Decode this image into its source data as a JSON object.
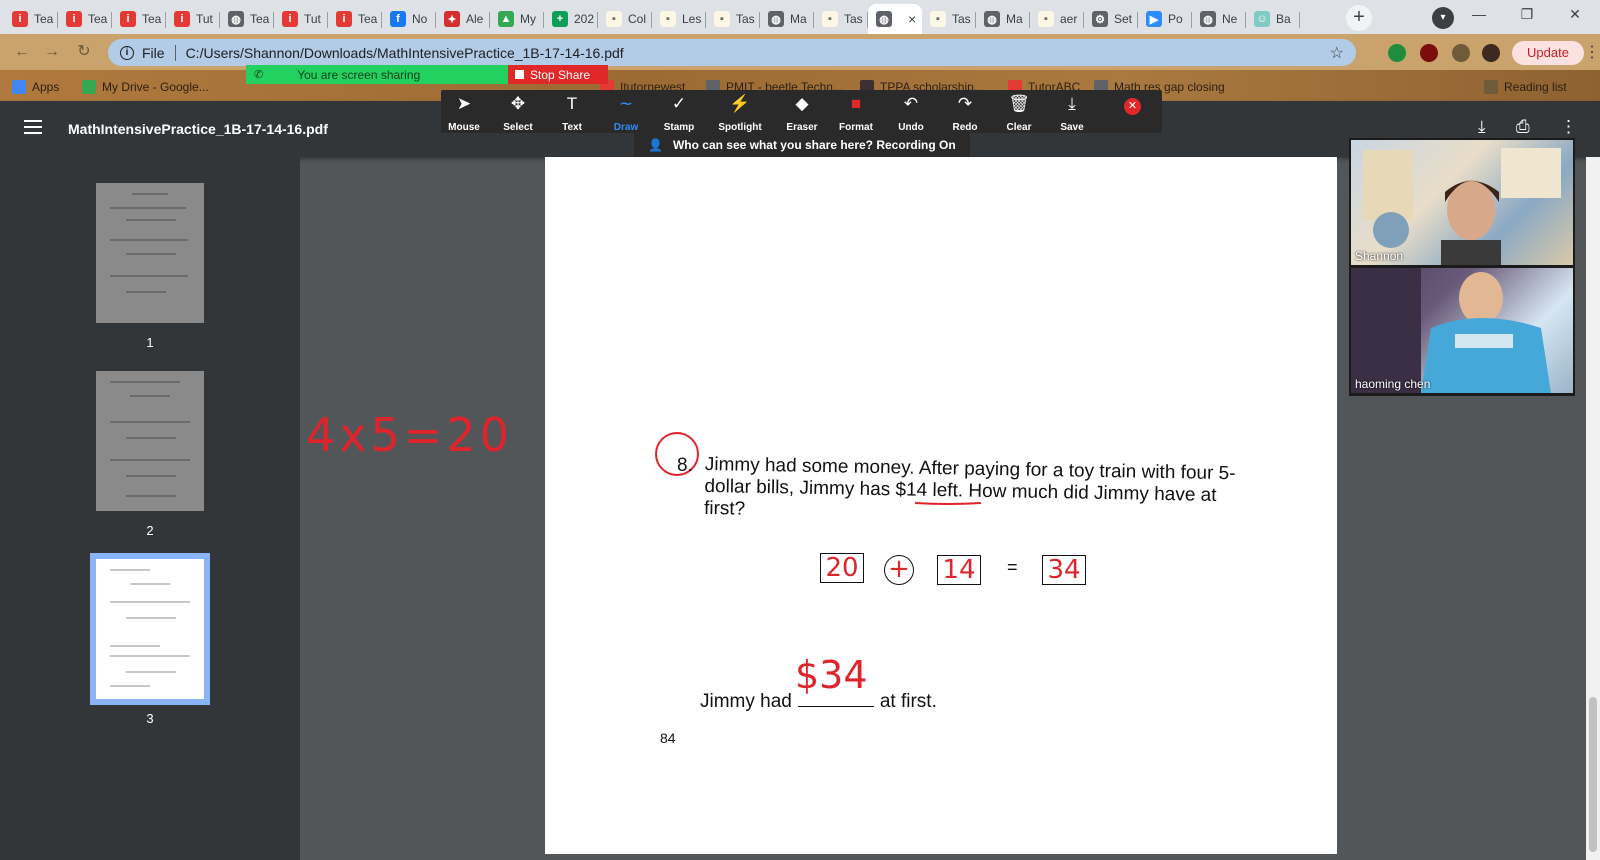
{
  "browser": {
    "tabs": [
      {
        "label": "Tea",
        "icon": "i-brand-icon",
        "color": "#e53935",
        "glyph": "i"
      },
      {
        "label": "Tea",
        "icon": "i-brand-icon",
        "color": "#e53935",
        "glyph": "i"
      },
      {
        "label": "Tea",
        "icon": "i-brand-icon",
        "color": "#e53935",
        "glyph": "i"
      },
      {
        "label": "Tut",
        "icon": "i-brand-icon",
        "color": "#e53935",
        "glyph": "i"
      },
      {
        "label": "Tea",
        "icon": "globe-icon",
        "color": "#5f6368",
        "glyph": "◍"
      },
      {
        "label": "Tut",
        "icon": "i-brand-icon",
        "color": "#e53935",
        "glyph": "i"
      },
      {
        "label": "Tea",
        "icon": "i-brand-icon",
        "color": "#e53935",
        "glyph": "i"
      },
      {
        "label": "No",
        "icon": "facebook-icon",
        "color": "#1877f2",
        "glyph": "f"
      },
      {
        "label": "Ale",
        "icon": "maple-leaf-icon",
        "color": "#d32f2f",
        "glyph": "✦"
      },
      {
        "label": "My",
        "icon": "drive-icon",
        "color": "#34a853",
        "glyph": "▲"
      },
      {
        "label": "202",
        "icon": "sheets-plus-icon",
        "color": "#0f9d58",
        "glyph": "+"
      },
      {
        "label": "Col",
        "icon": "document-icon",
        "color": "#fbf7e4",
        "glyph": "▪"
      },
      {
        "label": "Les",
        "icon": "document-icon",
        "color": "#fbf7e4",
        "glyph": "▪"
      },
      {
        "label": "Tas",
        "icon": "document-icon",
        "color": "#fbf7e4",
        "glyph": "▪"
      },
      {
        "label": "Ma",
        "icon": "globe-icon",
        "color": "#5f6368",
        "glyph": "◍"
      },
      {
        "label": "Tas",
        "icon": "document-icon",
        "color": "#fbf7e4",
        "glyph": "▪"
      },
      {
        "label": "",
        "icon": "globe-icon",
        "color": "#5f6368",
        "glyph": "◍",
        "active": true
      },
      {
        "label": "Tas",
        "icon": "document-icon",
        "color": "#fbf7e4",
        "glyph": "▪"
      },
      {
        "label": "Ma",
        "icon": "globe-icon",
        "color": "#5f6368",
        "glyph": "◍"
      },
      {
        "label": "aer",
        "icon": "document-icon",
        "color": "#fbf7e4",
        "glyph": "▪"
      },
      {
        "label": "Set",
        "icon": "gear-icon",
        "color": "#5f6368",
        "glyph": "⚙"
      },
      {
        "label": "Po",
        "icon": "zoom-icon",
        "color": "#2d8cff",
        "glyph": "▶"
      },
      {
        "label": "Ne",
        "icon": "chrome-icon",
        "color": "#5f6368",
        "glyph": "◍"
      },
      {
        "label": "Ba",
        "icon": "robot-icon",
        "color": "#80cbc4",
        "glyph": "☺"
      }
    ],
    "active_tab_close": "×",
    "new_tab": "+",
    "url_scheme_label": "File",
    "url": "C:/Users/Shannon/Downloads/MathIntensivePractice_1B-17-14-16.pdf",
    "update_label": "Update",
    "bookmarks": [
      {
        "label": "Apps",
        "color": "#4285f4"
      },
      {
        "label": "My Drive - Google...",
        "color": "#34a853"
      },
      {
        "label": "Itutornewest",
        "color": "#e53935"
      },
      {
        "label": "PMIT - beetle Techn...",
        "color": "#5f6368"
      },
      {
        "label": "TPPA scholarship...",
        "color": "#3c2f2f"
      },
      {
        "label": "TutorABC",
        "color": "#e53935"
      },
      {
        "label": "Math res gap closing",
        "color": "#5f6368"
      },
      {
        "label": "Reading list",
        "color": "#6f5a3a"
      }
    ]
  },
  "zoom": {
    "sharing_text": "You are screen sharing",
    "stop_share": "Stop Share",
    "tools": [
      {
        "label": "Mouse",
        "icon": "mouse-pointer-icon",
        "glyph": "➤"
      },
      {
        "label": "Select",
        "icon": "move-icon",
        "glyph": "✥"
      },
      {
        "label": "Text",
        "icon": "text-icon",
        "glyph": "T"
      },
      {
        "label": "Draw",
        "icon": "draw-icon",
        "glyph": "∼",
        "active": true
      },
      {
        "label": "Stamp",
        "icon": "stamp-check-icon",
        "glyph": "✓"
      },
      {
        "label": "Spotlight",
        "icon": "spotlight-wand-icon",
        "glyph": "⚡"
      },
      {
        "label": "Eraser",
        "icon": "eraser-icon",
        "glyph": "◆"
      },
      {
        "label": "Format",
        "icon": "format-color-icon",
        "glyph": "■"
      },
      {
        "label": "Undo",
        "icon": "undo-icon",
        "glyph": "↶"
      },
      {
        "label": "Redo",
        "icon": "redo-icon",
        "glyph": "↷"
      },
      {
        "label": "Clear",
        "icon": "trash-icon",
        "glyph": "🗑"
      },
      {
        "label": "Save",
        "icon": "save-download-icon",
        "glyph": "⤓"
      }
    ],
    "recording_notice": "Who can see what you share here? Recording On",
    "participants": [
      {
        "name": "Shannon"
      },
      {
        "name": "haoming  chen"
      }
    ]
  },
  "pdf": {
    "title": "MathIntensivePractice_1B-17-14-16.pdf",
    "thumbnails": [
      "1",
      "2",
      "3"
    ],
    "selected_page": "3",
    "question_number": "8.",
    "question_text": "Jimmy had some money. After paying for a toy train with four 5-dollar  bills, Jimmy has $14 left. How much did Jimmy have at first?",
    "answer_prefix": "Jimmy had",
    "answer_suffix": "at first.",
    "page_number": "84"
  },
  "annotations": {
    "side_equation": "4x5=20",
    "box1": "20",
    "operator": "+",
    "box2": "14",
    "equals": "=",
    "box3": "34",
    "answer": "$34"
  },
  "colors": {
    "ink": "#e0242c",
    "zoom_green": "#23d160",
    "zoom_red": "#e02828",
    "zoom_blue": "#2d8cff",
    "chrome_dark": "#323639"
  }
}
